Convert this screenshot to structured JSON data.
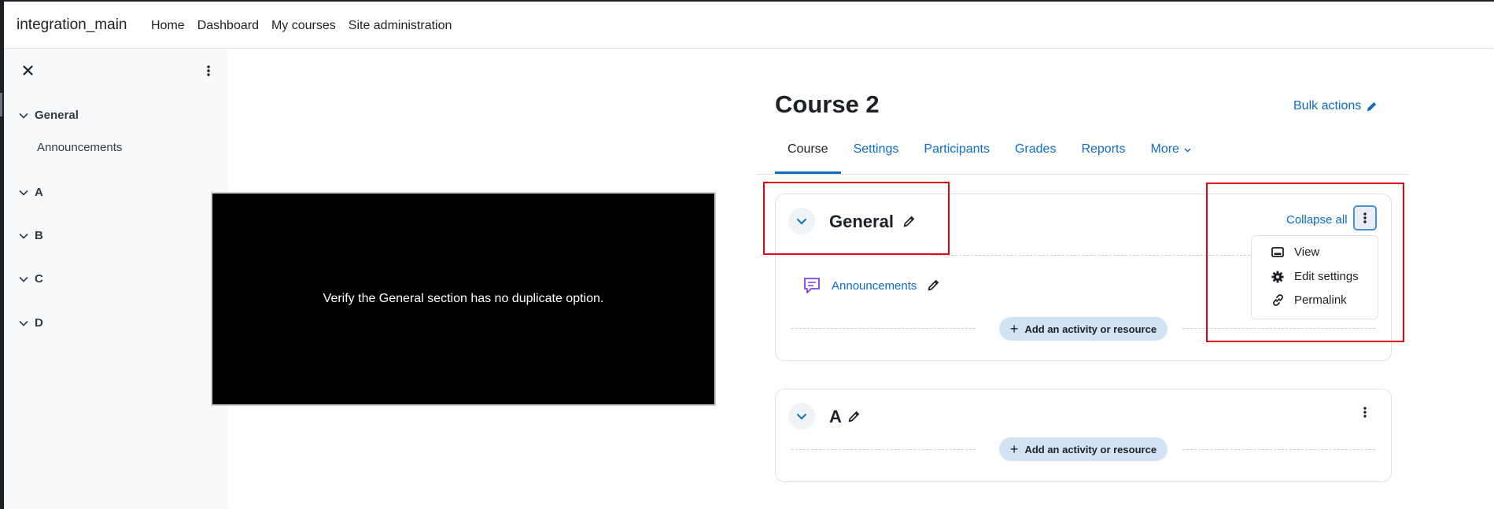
{
  "navbar": {
    "site_name": "integration_main",
    "links": [
      "Home",
      "Dashboard",
      "My courses",
      "Site administration"
    ]
  },
  "drawer": {
    "close_icon": "close-icon",
    "menu_icon": "kebab-icon",
    "sections": [
      {
        "label": "General",
        "items": [
          "Announcements"
        ]
      },
      {
        "label": "A"
      },
      {
        "label": "B"
      },
      {
        "label": "C"
      },
      {
        "label": "D"
      }
    ]
  },
  "overlay": {
    "message": "Verify the General section has no duplicate option."
  },
  "course": {
    "title": "Course 2",
    "bulk_actions": "Bulk actions",
    "tabs": [
      "Course",
      "Settings",
      "Participants",
      "Grades",
      "Reports",
      "More"
    ],
    "active_tab": "Course"
  },
  "sections": [
    {
      "title": "General",
      "collapse_all": "Collapse all",
      "activities": [
        {
          "name": "Announcements",
          "icon": "forum-icon"
        }
      ],
      "add_label": "Add an activity or resource"
    },
    {
      "title": "A",
      "add_label": "Add an activity or resource"
    }
  ],
  "section_menu": {
    "items": [
      {
        "label": "View",
        "icon": "view-icon"
      },
      {
        "label": "Edit settings",
        "icon": "gear-icon"
      },
      {
        "label": "Permalink",
        "icon": "link-icon"
      }
    ]
  },
  "colors": {
    "accent": "#0f6cbf",
    "highlight": "#e3001b",
    "add_button": "#d1e2f2",
    "forum_icon": "#7b40f2"
  }
}
